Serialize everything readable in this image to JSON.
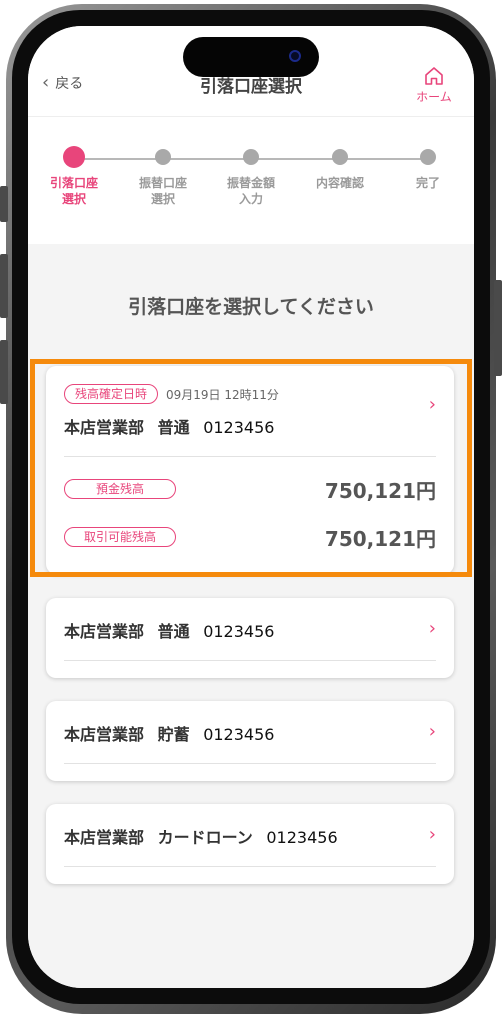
{
  "header": {
    "back_label": "戻る",
    "title": "引落口座選択",
    "home_label": "ホーム",
    "home_icon": "home-icon"
  },
  "stepper": {
    "steps": [
      {
        "label_line1": "引落口座",
        "label_line2": "選択",
        "active": true
      },
      {
        "label_line1": "振替口座",
        "label_line2": "選択",
        "active": false
      },
      {
        "label_line1": "振替金額",
        "label_line2": "入力",
        "active": false
      },
      {
        "label_line1": "内容確認",
        "label_line2": "",
        "active": false
      },
      {
        "label_line1": "完了",
        "label_line2": "",
        "active": false
      }
    ]
  },
  "instruction": "引落口座を選択してください",
  "cards": [
    {
      "badge": "残高確定日時",
      "datetime": "09月19日 12時11分",
      "branch": "本店営業部",
      "type": "普通",
      "number": "0123456",
      "balances": [
        {
          "label": "預金残高",
          "amount": "750,121円"
        },
        {
          "label": "取引可能残高",
          "amount": "750,121円"
        }
      ]
    },
    {
      "branch": "本店営業部",
      "type": "普通",
      "number": "0123456"
    },
    {
      "branch": "本店営業部",
      "type": "貯蓄",
      "number": "0123456"
    },
    {
      "branch": "本店営業部",
      "type": "カードローン",
      "number": "0123456"
    }
  ],
  "colors": {
    "accent": "#e8457b",
    "highlight": "#f58a0c",
    "inactive": "#a9a9a9"
  }
}
